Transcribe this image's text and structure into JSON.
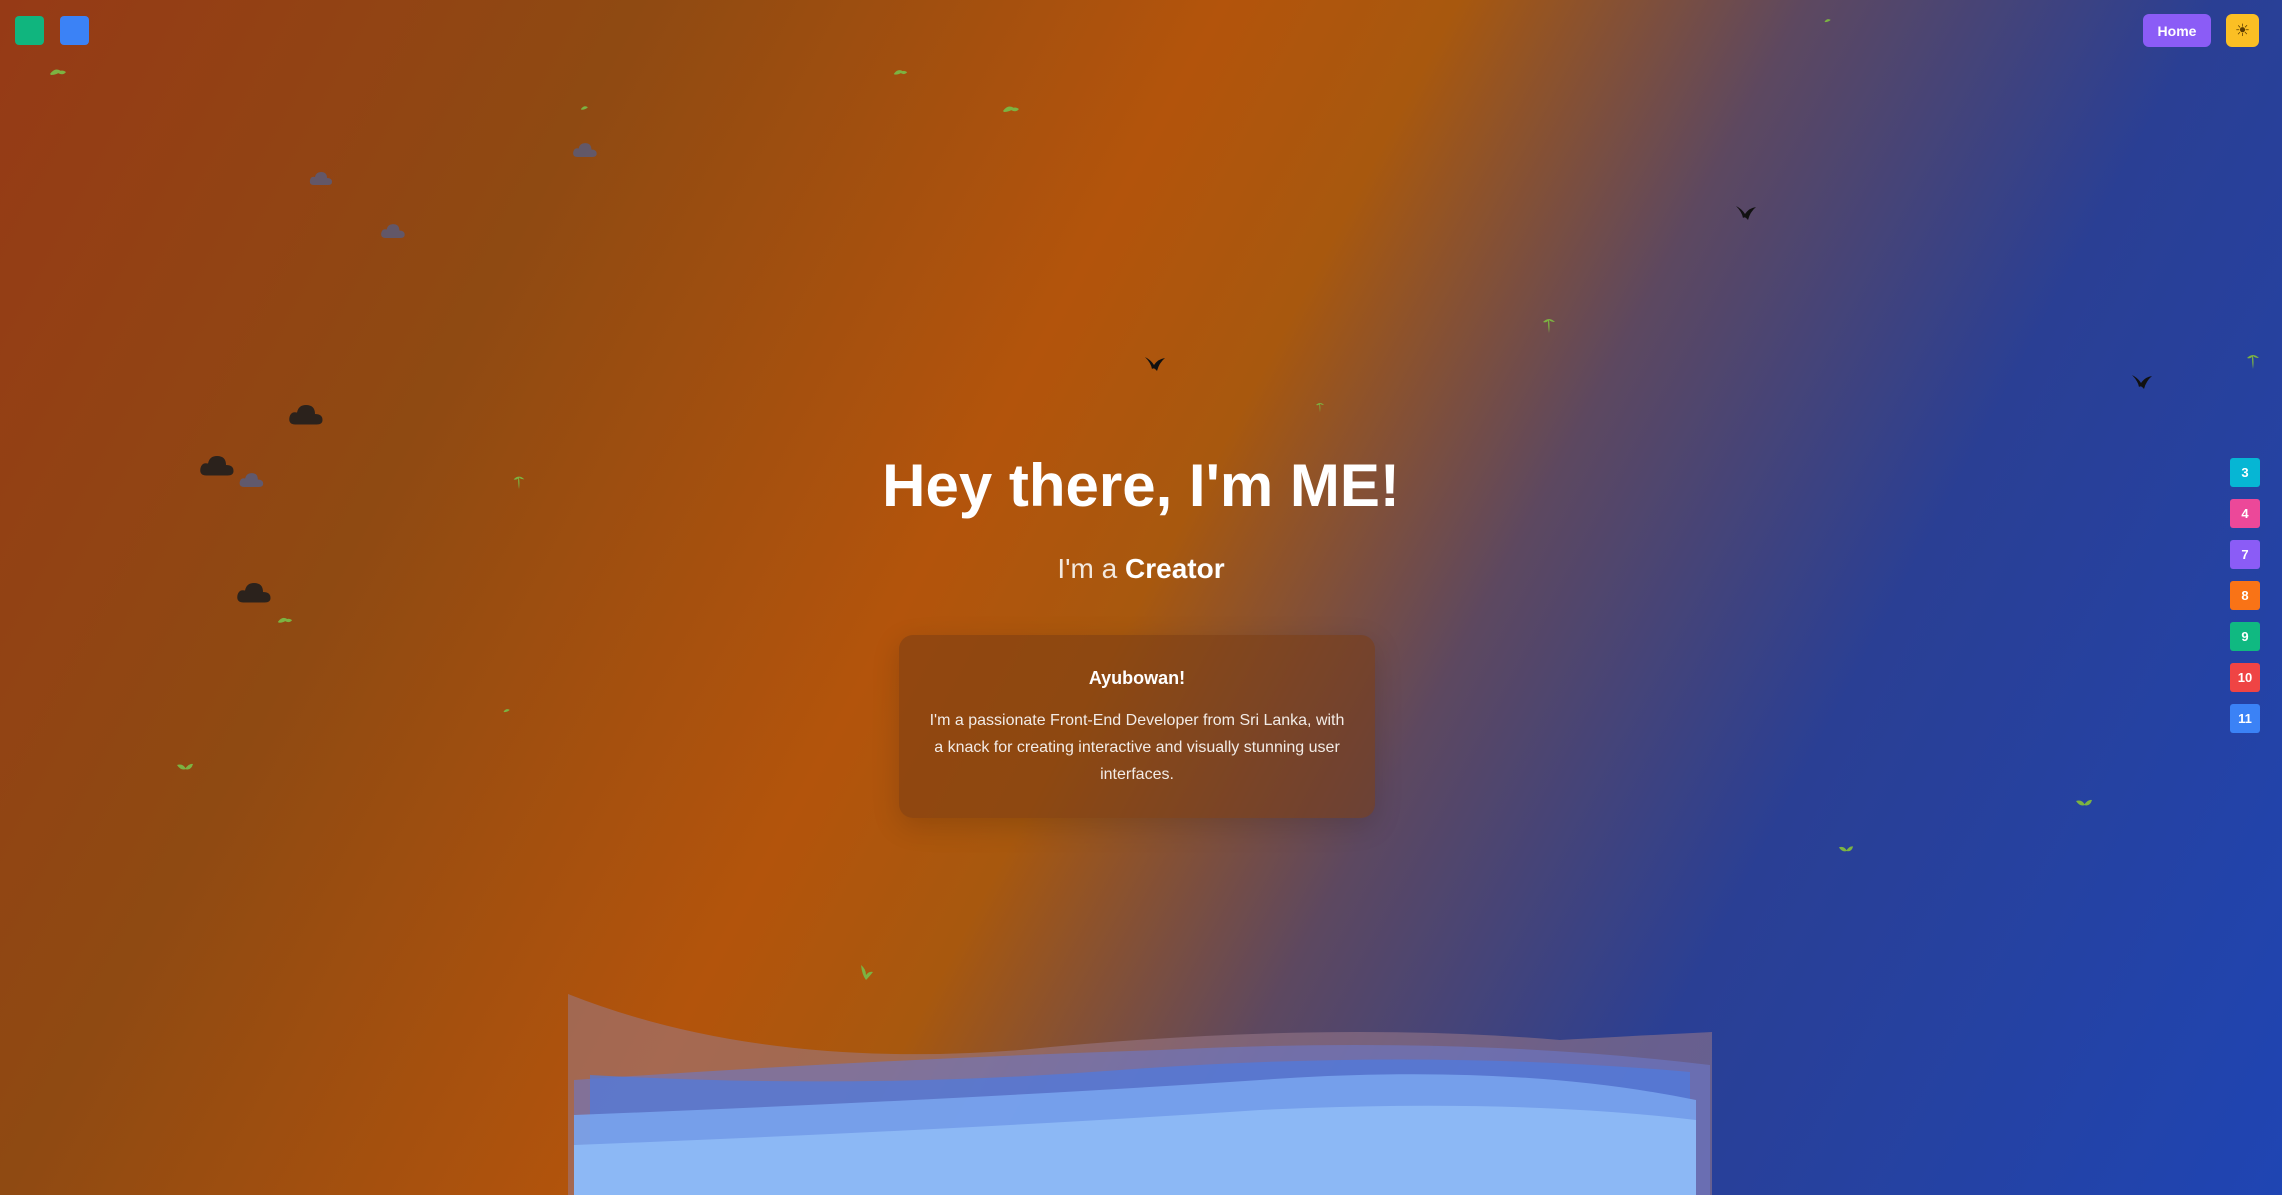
{
  "nav": {
    "home_label": "Home",
    "theme_icon": "sun-icon"
  },
  "hero": {
    "title": "Hey there, I'm ME!",
    "subtitle_prefix": "I'm a",
    "subtitle_role": "Creator"
  },
  "card": {
    "title": "Ayubowan!",
    "text": "I'm a passionate Front-End Developer from Sri Lanka, with a knack for creating interactive and visually stunning user interfaces."
  },
  "side_nav": [
    {
      "label": "3",
      "color": "#06b6d4"
    },
    {
      "label": "4",
      "color": "#ec4899"
    },
    {
      "label": "7",
      "color": "#8b5cf6"
    },
    {
      "label": "8",
      "color": "#f97316"
    },
    {
      "label": "9",
      "color": "#10b981"
    },
    {
      "label": "10",
      "color": "#ef4444"
    },
    {
      "label": "11",
      "color": "#3b82f6"
    }
  ],
  "colors": {
    "accent_green": "#10b57e",
    "accent_blue": "#3b82f6",
    "home_button": "#8b5cf6",
    "theme_button": "#fbbf24"
  }
}
